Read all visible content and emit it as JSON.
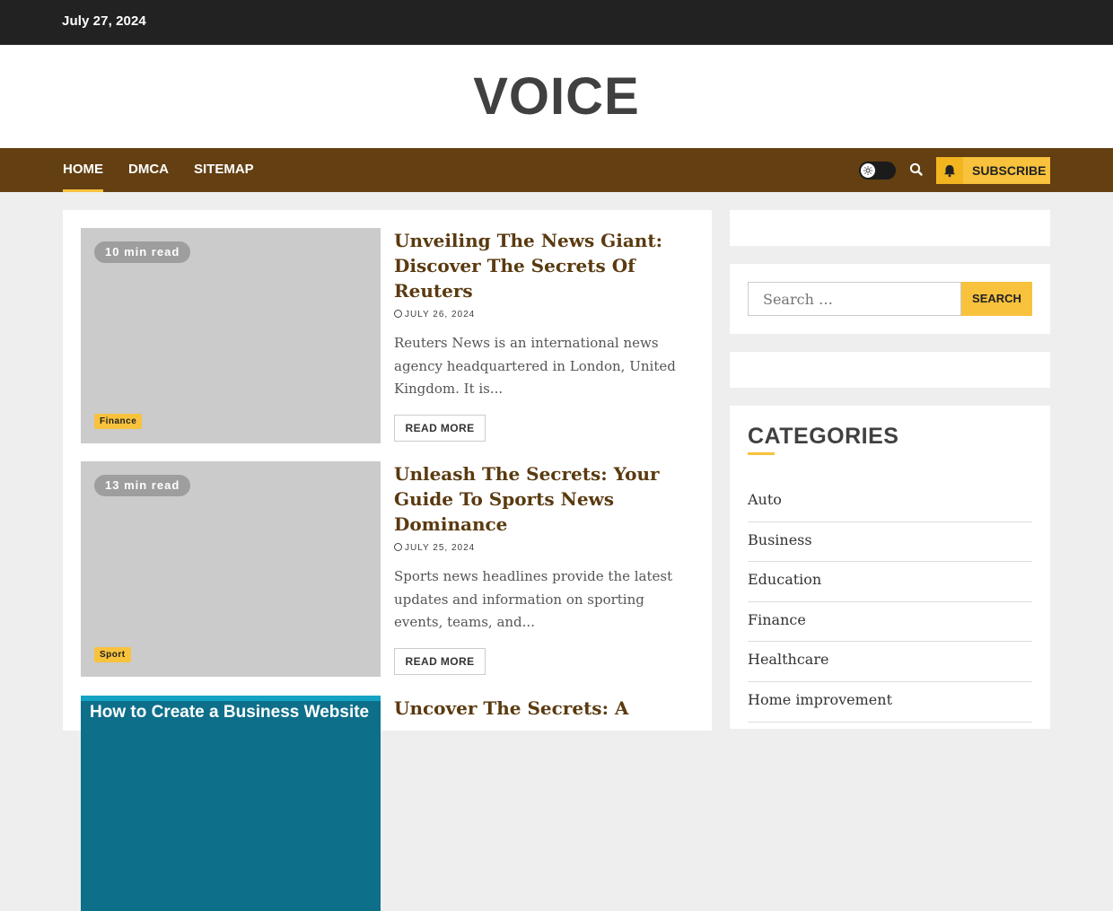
{
  "topbar": {
    "date": "July 27, 2024"
  },
  "site": {
    "title": "VOICE"
  },
  "nav": {
    "items": [
      {
        "label": "HOME",
        "active": true
      },
      {
        "label": "DMCA",
        "active": false
      },
      {
        "label": "SITEMAP",
        "active": false
      }
    ],
    "subscribe_label": "SUBSCRIBE"
  },
  "colors": {
    "topbar": "#222222",
    "navbar": "#633f12",
    "accent": "#f8c23d",
    "title_text": "#404040"
  },
  "articles": [
    {
      "read_time": "10 min read",
      "category": "Finance",
      "title": "Unveiling The News Giant: Discover The Secrets Of Reuters",
      "date": "JULY 26, 2024",
      "excerpt": "Reuters News is an international news agency headquartered in London, United Kingdom. It is...",
      "read_more": "READ MORE"
    },
    {
      "read_time": "13 min read",
      "category": "Sport",
      "title": "Unleash The Secrets: Your Guide To Sports News Dominance",
      "date": "JULY 25, 2024",
      "excerpt": "Sports news headlines provide the latest updates and information on sporting events, teams, and...",
      "read_more": "READ MORE"
    },
    {
      "title": "Uncover The Secrets: A",
      "image_caption": "How to Create a Business Website"
    }
  ],
  "sidebar": {
    "search_placeholder": "Search …",
    "search_button": "SEARCH",
    "categories_heading": "CATEGORIES",
    "categories": [
      "Auto",
      "Business",
      "Education",
      "Finance",
      "Healthcare",
      "Home improvement"
    ]
  },
  "icons": {
    "theme_toggle": "sun-icon",
    "search": "search-icon",
    "subscribe": "bell-icon",
    "date": "clock-icon"
  }
}
